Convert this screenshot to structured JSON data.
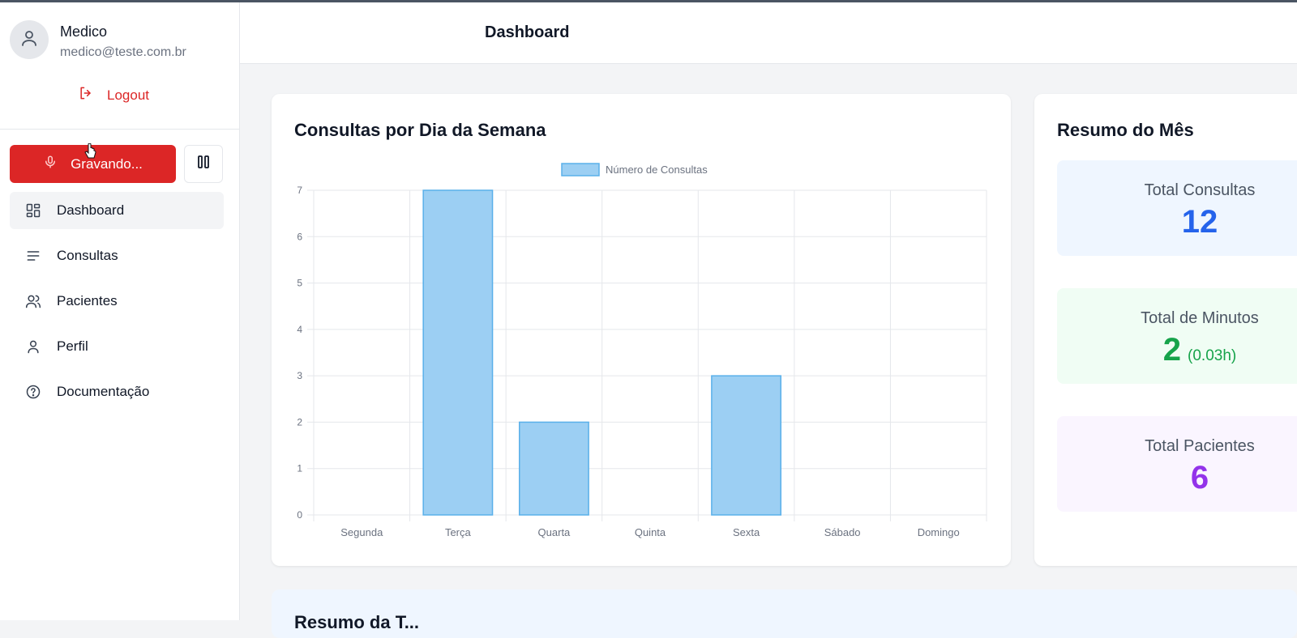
{
  "user": {
    "name": "Medico",
    "email": "medico@teste.com.br"
  },
  "logout_label": "Logout",
  "recording": {
    "label": "Gravando..."
  },
  "nav": {
    "items": [
      {
        "label": "Dashboard",
        "icon": "dashboard-icon",
        "active": true
      },
      {
        "label": "Consultas",
        "icon": "list-icon",
        "active": false
      },
      {
        "label": "Pacientes",
        "icon": "users-icon",
        "active": false
      },
      {
        "label": "Perfil",
        "icon": "user-icon",
        "active": false
      },
      {
        "label": "Documentação",
        "icon": "help-circle-icon",
        "active": false
      }
    ]
  },
  "header": {
    "title": "Dashboard"
  },
  "chart_card": {
    "title": "Consultas por Dia da Semana"
  },
  "chart_data": {
    "type": "bar",
    "categories": [
      "Segunda",
      "Terça",
      "Quarta",
      "Quinta",
      "Sexta",
      "Sábado",
      "Domingo"
    ],
    "series": [
      {
        "name": "Número de Consultas",
        "values": [
          0,
          7,
          2,
          0,
          3,
          0,
          0
        ]
      }
    ],
    "ylim": [
      0,
      7
    ],
    "yticks": [
      "0",
      "1",
      "2",
      "3",
      "4",
      "5",
      "6",
      "7"
    ],
    "grid": true,
    "legend": "top",
    "color": "#9ccff3",
    "border_color": "#5ab0ea"
  },
  "summary": {
    "title": "Resumo do Mês",
    "total_consultas": {
      "label": "Total Consultas",
      "value": "12"
    },
    "total_minutos": {
      "label": "Total de Minutos",
      "value": "2",
      "sub": "(0.03h)"
    },
    "total_pacientes": {
      "label": "Total Pacientes",
      "value": "6"
    }
  },
  "bottom_card": {
    "title": "Resumo da T..."
  },
  "colors": {
    "accent_red": "#dc2626",
    "blue": "#2563eb",
    "green": "#16a34a",
    "purple": "#9333ea"
  }
}
